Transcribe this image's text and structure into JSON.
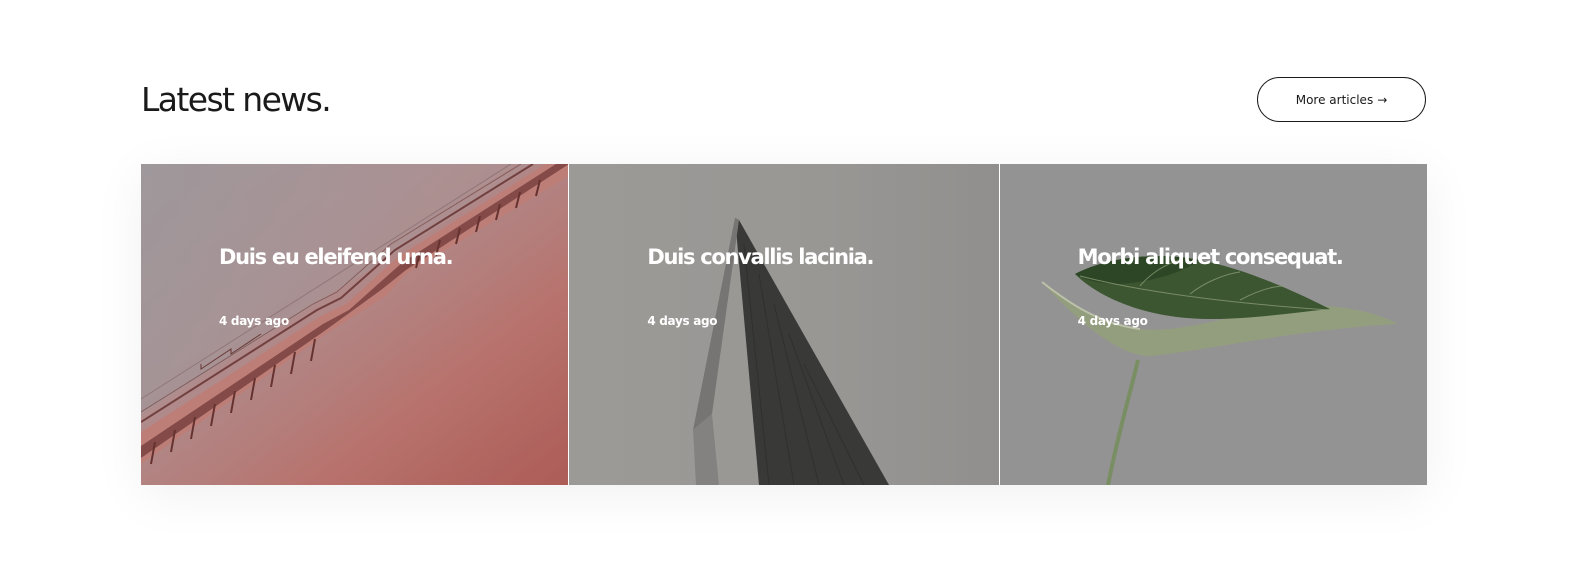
{
  "section": {
    "title": "Latest news.",
    "more_button_label": "More articles",
    "more_button_arrow": "→"
  },
  "articles": [
    {
      "title": "Duis eu eleifend urna.",
      "date": "4 days ago",
      "image": "red-staircase-photo"
    },
    {
      "title": "Duis convallis lacinia.",
      "date": "4 days ago",
      "image": "concrete-tower-photo"
    },
    {
      "title": "Morbi aliquet consequat.",
      "date": "4 days ago",
      "image": "green-leaf-photo"
    }
  ],
  "colors": {
    "text": "#1a1a1a",
    "card_overlay_text": "#ffffff",
    "card1_tone": "#c56d67",
    "card2_tone": "#9f9d9a",
    "card3_tone": "#9a9a9a"
  }
}
